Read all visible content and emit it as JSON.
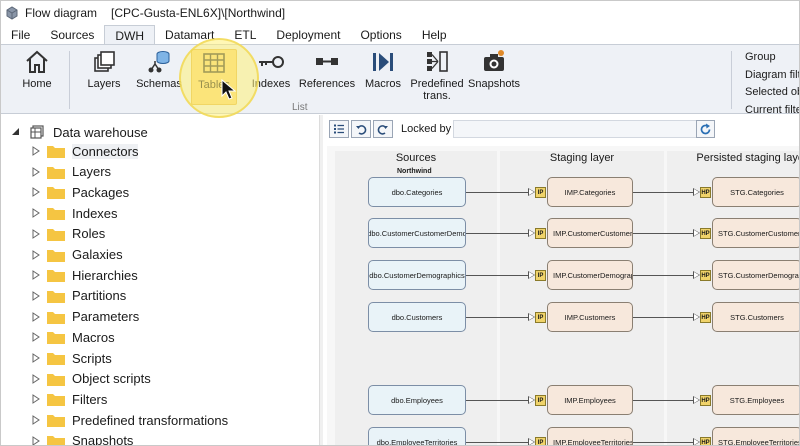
{
  "window": {
    "app_name": "Flow diagram",
    "document_title": "[CPC-Gusta-ENL6X]\\[Northwind]"
  },
  "menu": {
    "tabs": [
      {
        "label": "File"
      },
      {
        "label": "Sources"
      },
      {
        "label": "DWH",
        "active": true
      },
      {
        "label": "Datamart"
      },
      {
        "label": "ETL"
      },
      {
        "label": "Deployment"
      },
      {
        "label": "Options"
      },
      {
        "label": "Help"
      }
    ]
  },
  "ribbon": {
    "home_label": "Home",
    "layers_label": "Layers",
    "schemas_label": "Schemas",
    "tables_label": "Tables",
    "indexes_label": "Indexes",
    "references_label": "References",
    "macros_label": "Macros",
    "predefined_label_1": "Predefined",
    "predefined_label_2": "trans.",
    "snapshots_label": "Snapshots",
    "group_label": "List",
    "right_items": [
      "Group",
      "Diagram filte",
      "Selected obje",
      "Current filter"
    ],
    "selected_color": "#f5d57c"
  },
  "tree": {
    "root_label": "Data warehouse",
    "items": [
      {
        "label": "Connectors"
      },
      {
        "label": "Layers"
      },
      {
        "label": "Packages"
      },
      {
        "label": "Indexes"
      },
      {
        "label": "Roles"
      },
      {
        "label": "Galaxies"
      },
      {
        "label": "Hierarchies"
      },
      {
        "label": "Partitions"
      },
      {
        "label": "Parameters"
      },
      {
        "label": "Macros"
      },
      {
        "label": "Scripts"
      },
      {
        "label": "Object scripts"
      },
      {
        "label": "Filters"
      },
      {
        "label": "Predefined transformations"
      },
      {
        "label": "Snapshots"
      }
    ],
    "folder_color": "#f5c542"
  },
  "diagram": {
    "locked_by_label": "Locked by",
    "locked_by_value": "",
    "columns": [
      {
        "title": "Sources"
      },
      {
        "title": "Staging layer"
      },
      {
        "title": "Persisted staging layer"
      }
    ],
    "source_group": "Northwind",
    "rows": [
      {
        "source": "dbo.Categories",
        "staging": "IMP.Categories",
        "persisted": "STG.Categories"
      },
      {
        "source": "dbo.CustomerCustomerDemo",
        "staging": "IMP.CustomerCustomerDemo",
        "persisted": "STG.CustomerCustomerDemo"
      },
      {
        "source": "dbo.CustomerDemographics",
        "staging": "IMP.CustomerDemographics",
        "persisted": "STG.CustomerDemographics"
      },
      {
        "source": "dbo.Customers",
        "staging": "IMP.Customers",
        "persisted": "STG.Customers"
      },
      {
        "source": "dbo.Employees",
        "staging": "IMP.Employees",
        "persisted": "STG.Employees"
      },
      {
        "source": "dbo.EmployeeTerritories",
        "staging": "IMP.EmployeeTerritories",
        "persisted": "STG.EmployeeTerritories"
      }
    ],
    "staging_badge": "IP",
    "persisted_badge": "HP"
  }
}
